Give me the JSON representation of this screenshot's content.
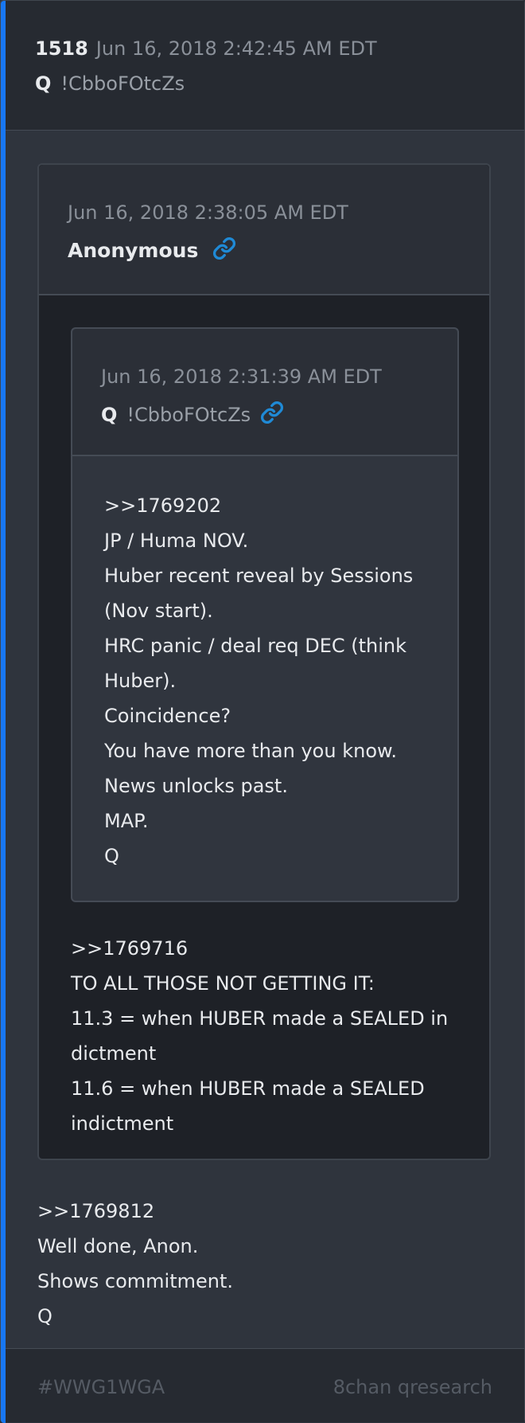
{
  "post": {
    "number": "1518",
    "date": "Jun 16, 2018 2:42:45 AM EDT",
    "author": "Q",
    "tripcode": "!CbboFOtcZs"
  },
  "quoted_post": {
    "date": "Jun 16, 2018 2:38:05 AM EDT",
    "author": "Anonymous",
    "link_icon": "link-icon",
    "body": [
      ">>1769716",
      "TO ALL THOSE NOT GETTING IT:",
      "11.3 = when HUBER made a SEALED in",
      "dictment",
      "11.6 = when HUBER made a SEALED",
      "indictment"
    ],
    "nested_quote": {
      "date": "Jun 16, 2018 2:31:39 AM EDT",
      "author": "Q",
      "tripcode": "!CbboFOtcZs",
      "link_icon": "link-icon",
      "body": [
        ">>1769202",
        "JP / Huma NOV.",
        "Huber recent reveal by Sessions",
        "(Nov start).",
        "HRC panic / deal req DEC (think",
        "Huber).",
        "Coincidence?",
        "You have more than you know.",
        "News unlocks past.",
        "MAP.",
        "Q"
      ]
    }
  },
  "body": [
    ">>1769812",
    "Well done, Anon.",
    "Shows commitment.",
    "Q"
  ],
  "footer": {
    "hashtag": "#WWG1WGA",
    "board": "8chan qresearch"
  },
  "colors": {
    "accent": "#1877f2",
    "link": "#1f8ad6",
    "background": "#2f343d",
    "header": "#262a31",
    "quote_dark": "#1e2127"
  }
}
